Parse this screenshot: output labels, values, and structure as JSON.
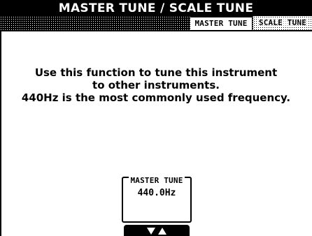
{
  "window": {
    "title": "MASTER TUNE / SCALE TUNE"
  },
  "tabs": [
    {
      "label": "MASTER TUNE",
      "active": true
    },
    {
      "label": "SCALE TUNE",
      "active": false
    }
  ],
  "message": {
    "line1": "Use this function to tune this instrument",
    "line2": "to other instruments.",
    "line3": "440Hz is the most commonly used frequency."
  },
  "parameter": {
    "label": "MASTER TUNE",
    "value": "440.0Hz"
  },
  "controls": {
    "adjust_icons": [
      "triangle-down-icon",
      "triangle-up-icon"
    ]
  },
  "colors": {
    "foreground": "#000000",
    "background": "#ffffff"
  }
}
